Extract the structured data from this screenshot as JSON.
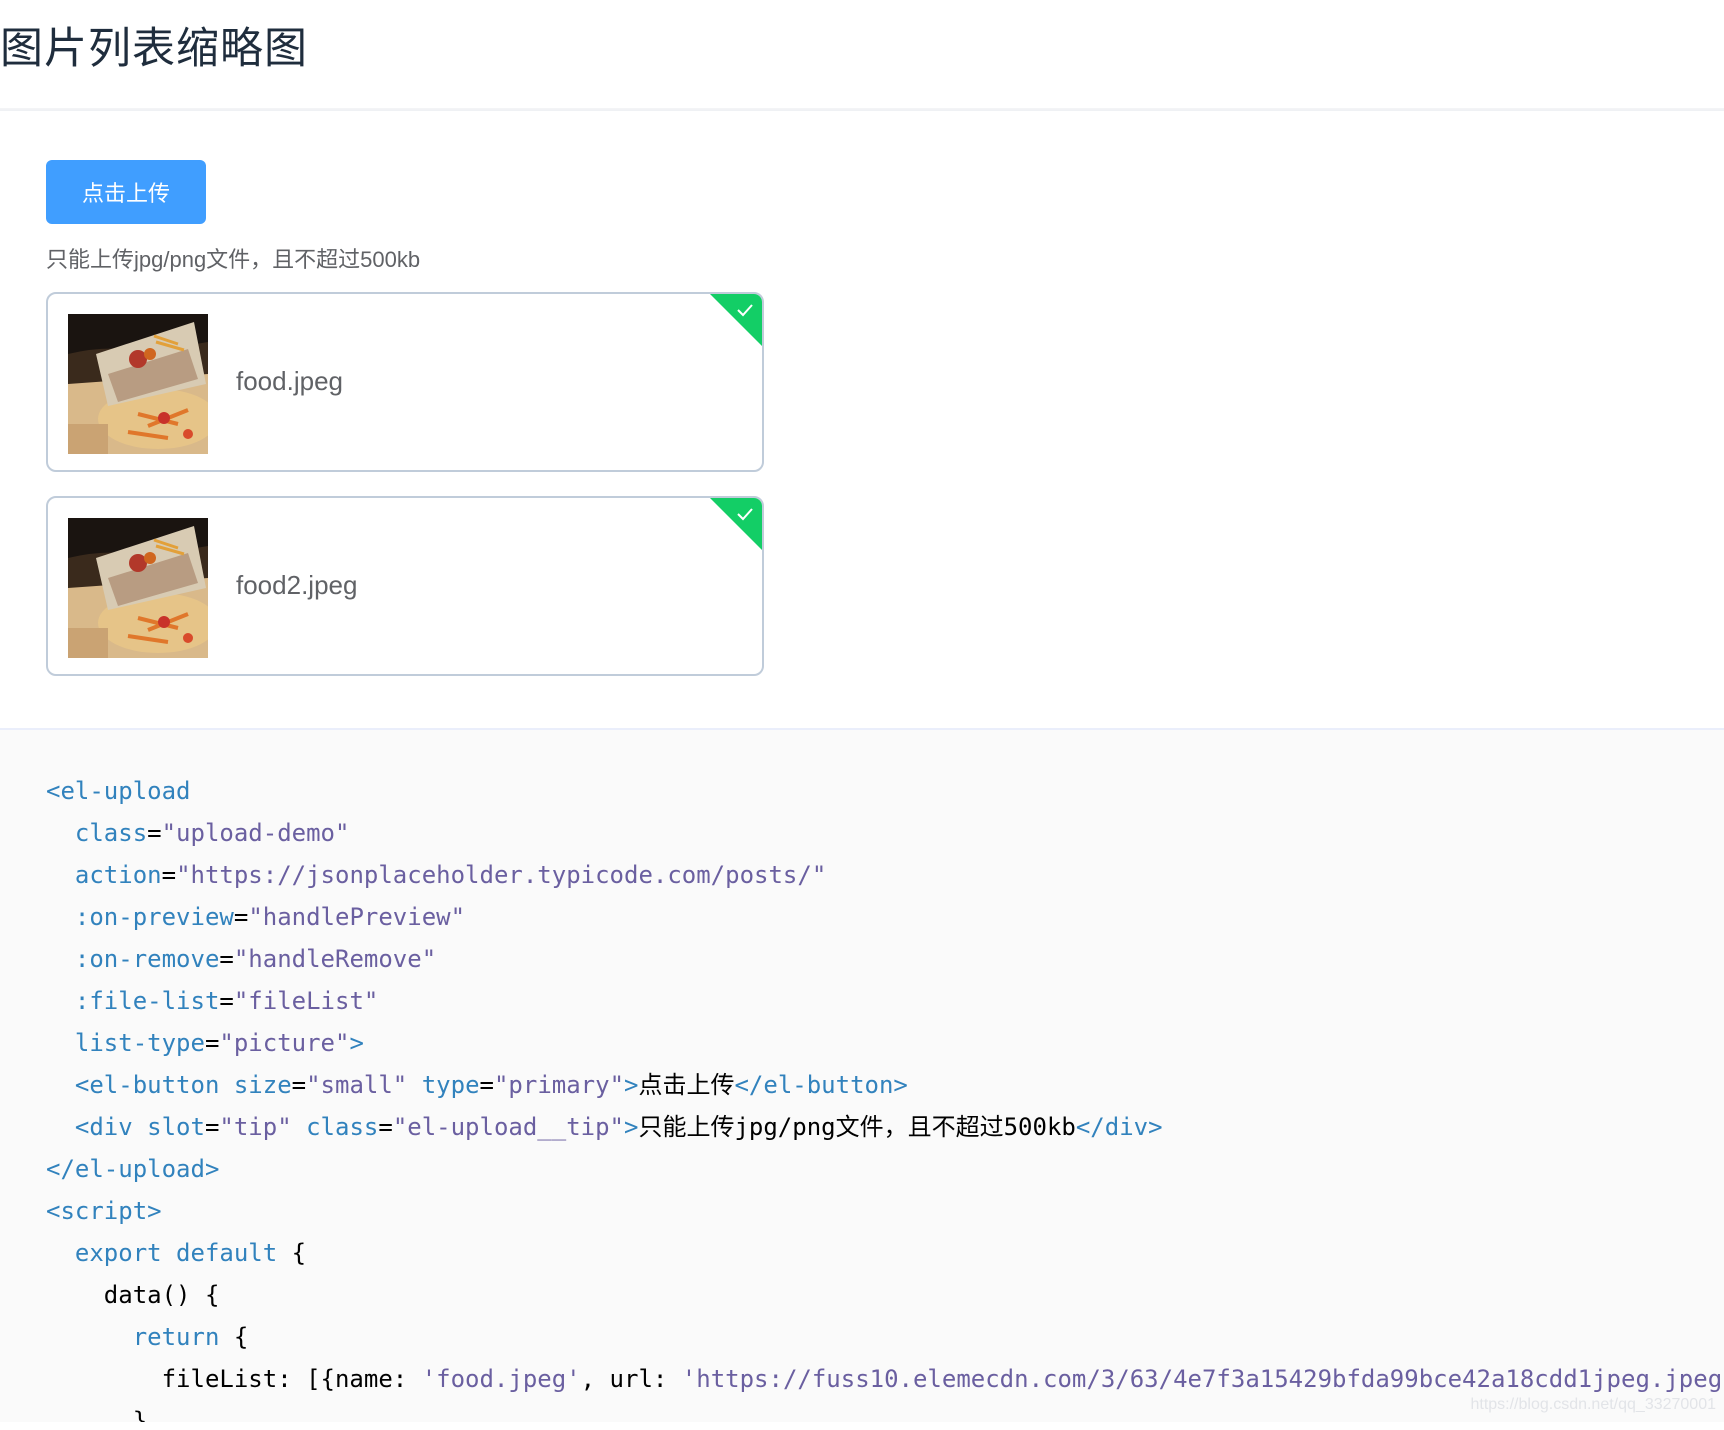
{
  "page": {
    "title": "图片列表缩略图"
  },
  "upload": {
    "button_label": "点击上传",
    "tip": "只能上传jpg/png文件，且不超过500kb",
    "files": [
      {
        "name": "food.jpeg",
        "status": "success",
        "thumbnail_icon": "food-thumbnail",
        "status_icon": "check-icon"
      },
      {
        "name": "food2.jpeg",
        "status": "success",
        "thumbnail_icon": "food-thumbnail",
        "status_icon": "check-icon"
      }
    ],
    "accent_color": "#409eff",
    "success_color": "#13ce66"
  },
  "code": {
    "lines": [
      [
        {
          "c": "t",
          "v": "<el-upload"
        }
      ],
      [
        {
          "c": "p",
          "v": "  "
        },
        {
          "c": "a",
          "v": "class"
        },
        {
          "c": "p",
          "v": "="
        },
        {
          "c": "s",
          "v": "\"upload-demo\""
        }
      ],
      [
        {
          "c": "p",
          "v": "  "
        },
        {
          "c": "a",
          "v": "action"
        },
        {
          "c": "p",
          "v": "="
        },
        {
          "c": "s",
          "v": "\"https://jsonplaceholder.typicode.com/posts/\""
        }
      ],
      [
        {
          "c": "p",
          "v": "  "
        },
        {
          "c": "a",
          "v": ":on-preview"
        },
        {
          "c": "p",
          "v": "="
        },
        {
          "c": "s",
          "v": "\"handlePreview\""
        }
      ],
      [
        {
          "c": "p",
          "v": "  "
        },
        {
          "c": "a",
          "v": ":on-remove"
        },
        {
          "c": "p",
          "v": "="
        },
        {
          "c": "s",
          "v": "\"handleRemove\""
        }
      ],
      [
        {
          "c": "p",
          "v": "  "
        },
        {
          "c": "a",
          "v": ":file-list"
        },
        {
          "c": "p",
          "v": "="
        },
        {
          "c": "s",
          "v": "\"fileList\""
        }
      ],
      [
        {
          "c": "p",
          "v": "  "
        },
        {
          "c": "a",
          "v": "list-type"
        },
        {
          "c": "p",
          "v": "="
        },
        {
          "c": "s",
          "v": "\"picture\""
        },
        {
          "c": "t",
          "v": ">"
        }
      ],
      [
        {
          "c": "p",
          "v": "  "
        },
        {
          "c": "t",
          "v": "<el-button"
        },
        {
          "c": "p",
          "v": " "
        },
        {
          "c": "a",
          "v": "size"
        },
        {
          "c": "p",
          "v": "="
        },
        {
          "c": "s",
          "v": "\"small\""
        },
        {
          "c": "p",
          "v": " "
        },
        {
          "c": "a",
          "v": "type"
        },
        {
          "c": "p",
          "v": "="
        },
        {
          "c": "s",
          "v": "\"primary\""
        },
        {
          "c": "t",
          "v": ">"
        },
        {
          "c": "p",
          "v": "点击上传"
        },
        {
          "c": "t",
          "v": "</el-button>"
        }
      ],
      [
        {
          "c": "p",
          "v": "  "
        },
        {
          "c": "t",
          "v": "<div"
        },
        {
          "c": "p",
          "v": " "
        },
        {
          "c": "a",
          "v": "slot"
        },
        {
          "c": "p",
          "v": "="
        },
        {
          "c": "s",
          "v": "\"tip\""
        },
        {
          "c": "p",
          "v": " "
        },
        {
          "c": "a",
          "v": "class"
        },
        {
          "c": "p",
          "v": "="
        },
        {
          "c": "s",
          "v": "\"el-upload__tip\""
        },
        {
          "c": "t",
          "v": ">"
        },
        {
          "c": "p",
          "v": "只能上传jpg/png文件，且不超过500kb"
        },
        {
          "c": "t",
          "v": "</div>"
        }
      ],
      [
        {
          "c": "t",
          "v": "</el-upload>"
        }
      ],
      [
        {
          "c": "t",
          "v": "<script>"
        }
      ],
      [
        {
          "c": "p",
          "v": "  "
        },
        {
          "c": "k",
          "v": "export default"
        },
        {
          "c": "p",
          "v": " {"
        }
      ],
      [
        {
          "c": "p",
          "v": "    data() {"
        }
      ],
      [
        {
          "c": "p",
          "v": "      "
        },
        {
          "c": "k",
          "v": "return"
        },
        {
          "c": "p",
          "v": " {"
        }
      ],
      [
        {
          "c": "p",
          "v": "        fileList: [{name: "
        },
        {
          "c": "s",
          "v": "'food.jpeg'"
        },
        {
          "c": "p",
          "v": ", url: "
        },
        {
          "c": "s",
          "v": "'https://fuss10.elemecdn.com/3/63/4e7f3a15429bfda99bce42a18cdd1jpeg.jpeg"
        }
      ],
      [
        {
          "c": "p",
          "v": "      },"
        }
      ]
    ]
  },
  "watermark": "https://blog.csdn.net/qq_33270001"
}
